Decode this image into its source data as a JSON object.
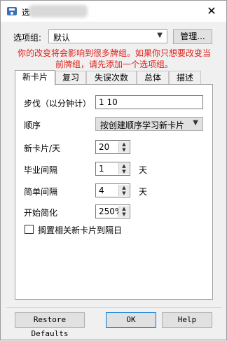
{
  "window": {
    "title": "选",
    "close_icon": "✕"
  },
  "options_group": {
    "label": "选项组:",
    "selected": "默认",
    "manage_label": "管理..."
  },
  "warning": {
    "line1": "你的改变将会影响到很多牌组。如果你只想要改变当",
    "line2": "前牌组，请先添加一个选项组。",
    "color": "#e0201a"
  },
  "tabs": [
    {
      "label": "新卡片"
    },
    {
      "label": "复习"
    },
    {
      "label": "失误次数"
    },
    {
      "label": "总体"
    },
    {
      "label": "描述"
    }
  ],
  "new_cards": {
    "steps_label": "步伐（以分钟计）",
    "steps_value": "1 10",
    "order_label": "顺序",
    "order_value": "按创建顺序学习新卡片",
    "per_day_label": "新卡片/天",
    "per_day_value": "20",
    "grad_label": "毕业间隔",
    "grad_value": "1",
    "grad_unit": "天",
    "easy_label": "简单间隔",
    "easy_value": "4",
    "easy_unit": "天",
    "ease_label": "开始简化",
    "ease_value": "250%",
    "bury_label": "搁置相关新卡片到隔日",
    "bury_checked": false
  },
  "buttons": {
    "restore": "Restore Defaults",
    "ok": "OK",
    "help": "Help"
  }
}
